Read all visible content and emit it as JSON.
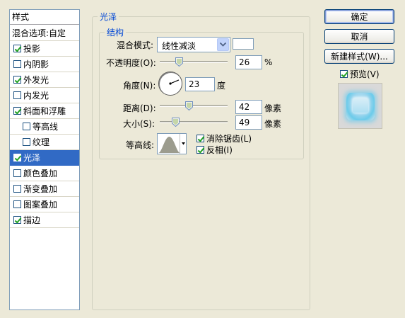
{
  "style_list": {
    "header": "样式",
    "items": [
      {
        "label": "混合选项:自定",
        "has_checkbox": false,
        "checked": false,
        "sub": false,
        "selected": false
      },
      {
        "label": "投影",
        "has_checkbox": true,
        "checked": true,
        "sub": false,
        "selected": false
      },
      {
        "label": "内阴影",
        "has_checkbox": true,
        "checked": false,
        "sub": false,
        "selected": false
      },
      {
        "label": "外发光",
        "has_checkbox": true,
        "checked": true,
        "sub": false,
        "selected": false
      },
      {
        "label": "内发光",
        "has_checkbox": true,
        "checked": false,
        "sub": false,
        "selected": false
      },
      {
        "label": "斜面和浮雕",
        "has_checkbox": true,
        "checked": true,
        "sub": false,
        "selected": false
      },
      {
        "label": "等高线",
        "has_checkbox": true,
        "checked": false,
        "sub": true,
        "selected": false
      },
      {
        "label": "纹理",
        "has_checkbox": true,
        "checked": false,
        "sub": true,
        "selected": false
      },
      {
        "label": "光泽",
        "has_checkbox": true,
        "checked": true,
        "sub": false,
        "selected": true
      },
      {
        "label": "颜色叠加",
        "has_checkbox": true,
        "checked": false,
        "sub": false,
        "selected": false
      },
      {
        "label": "渐变叠加",
        "has_checkbox": true,
        "checked": false,
        "sub": false,
        "selected": false
      },
      {
        "label": "图案叠加",
        "has_checkbox": true,
        "checked": false,
        "sub": false,
        "selected": false
      },
      {
        "label": "描边",
        "has_checkbox": true,
        "checked": true,
        "sub": false,
        "selected": false
      }
    ]
  },
  "gloss": {
    "group_title": "光泽",
    "structure_title": "结构",
    "blend_mode_label": "混合模式:",
    "blend_mode_value": "线性减淡",
    "swatch_color": "#FFFFFF",
    "opacity_label": "不透明度(O):",
    "opacity_value": "26",
    "opacity_unit": "%",
    "opacity_fraction": 0.26,
    "angle_label": "角度(N):",
    "angle_value": "23",
    "angle_unit": "度",
    "distance_label": "距离(D):",
    "distance_value": "42",
    "distance_unit": "像素",
    "distance_fraction": 0.42,
    "size_label": "大小(S):",
    "size_value": "49",
    "size_unit": "像素",
    "size_fraction": 0.2,
    "contour_label": "等高线:",
    "anti_alias_label": "消除锯齿(L)",
    "anti_alias_checked": true,
    "invert_label": "反相(I)",
    "invert_checked": true
  },
  "buttons": {
    "ok": "确定",
    "cancel": "取消",
    "new_style": "新建样式(W)...",
    "preview_label": "预览(V)",
    "preview_checked": true
  },
  "colors": {
    "dialog_bg": "#ECE9D8",
    "selection": "#316AC5",
    "group_title": "#0046D5",
    "glow": "#6CCBEA"
  },
  "icons": {
    "dropdown": "chevron-down-icon",
    "checkmark": "checkmark-icon",
    "slider_thumb": "slider-thumb-icon"
  }
}
